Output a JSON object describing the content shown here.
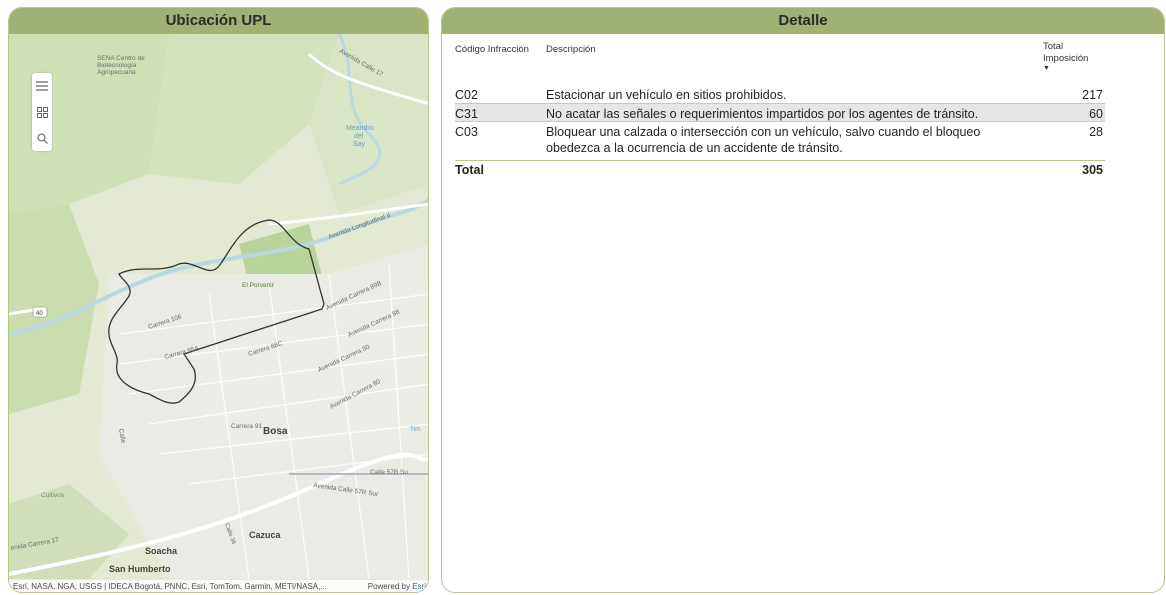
{
  "map_panel": {
    "title": "Ubicación UPL",
    "labels": {
      "sena": [
        "SENA Centro de",
        "Biotecnología",
        "Agropecuaria"
      ],
      "meandro": [
        "Meandro",
        "del",
        "Say"
      ],
      "av_calle_17": "Avenida Calle 17",
      "av_longitudinal": "Avenida Longitudinal d",
      "carrera_106": "Carrera 106",
      "el_porvenir": "El Porvenir",
      "av_carrera_89b": "Avenida Carrera 89B",
      "av_carrera_88": "Avenida Carrera 88",
      "carrera_95a": "Carrera 95A",
      "carrera_88c": "Carrera 88C",
      "av_carrera_90": "Avenida Carrera 90",
      "av_carrera_80": "Avenida Carrera 80",
      "route_40": "40",
      "carrera_91": "Carrera 91",
      "bosa": "Bosa",
      "tim": "Tim",
      "calle": "Calle",
      "calle_57b": "Calle 57B Su",
      "av_calle_57r": "Avenida Calle 57R Sur",
      "cultivos": "Cultivos",
      "cazuca": "Cazuca",
      "calle_36": "Calle 36",
      "av_carrera_17": "enida Carrera 17",
      "soacha": "Soacha",
      "san_humberto": "San Humberto"
    },
    "attribution": "Esri, NASA, NGA, USGS | IDECA Bogotá, PNNC, Esri, TomTom, Garmin, METI/NASA,...",
    "powered_by": "Powered by",
    "powered_by_link": "Esri",
    "toolbar": [
      "menu-icon",
      "qr-grid-icon",
      "search-icon"
    ]
  },
  "detail_panel": {
    "title": "Detalle",
    "columns": {
      "code": "Código Infracción",
      "desc": "Descripción",
      "total": "Total Imposición",
      "sort_indicator": "▼"
    },
    "rows": [
      {
        "code": "C02",
        "desc": "Estacionar un vehículo en sitios prohibidos.",
        "value": "217"
      },
      {
        "code": "C31",
        "desc": "No acatar las señales o requerimientos impartidos por los agentes de tránsito.",
        "value": "60"
      },
      {
        "code": "C03",
        "desc": "Bloquear una calzada o intersección con un vehículo, salvo cuando el bloqueo obedezca a la ocurrencia de un accidente de tránsito.",
        "value": "28"
      }
    ],
    "total_label": "Total",
    "total_value": "305"
  },
  "colors": {
    "header_bg": "#9fb173",
    "border": "#b5c78a",
    "selected_row": "#e6e6e6"
  }
}
